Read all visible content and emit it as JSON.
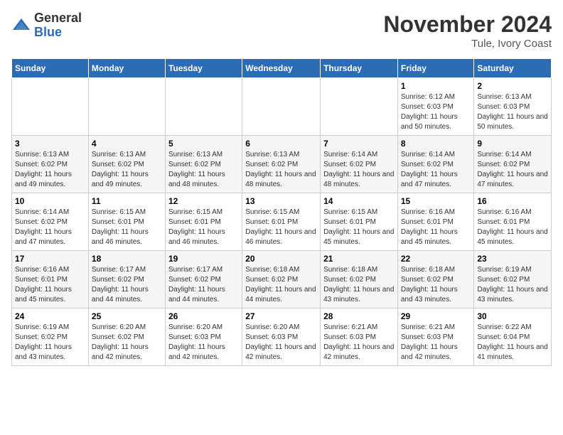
{
  "logo": {
    "general": "General",
    "blue": "Blue"
  },
  "title": "November 2024",
  "location": "Tule, Ivory Coast",
  "days_of_week": [
    "Sunday",
    "Monday",
    "Tuesday",
    "Wednesday",
    "Thursday",
    "Friday",
    "Saturday"
  ],
  "weeks": [
    [
      {
        "day": "",
        "info": ""
      },
      {
        "day": "",
        "info": ""
      },
      {
        "day": "",
        "info": ""
      },
      {
        "day": "",
        "info": ""
      },
      {
        "day": "",
        "info": ""
      },
      {
        "day": "1",
        "info": "Sunrise: 6:12 AM\nSunset: 6:03 PM\nDaylight: 11 hours and 50 minutes."
      },
      {
        "day": "2",
        "info": "Sunrise: 6:13 AM\nSunset: 6:03 PM\nDaylight: 11 hours and 50 minutes."
      }
    ],
    [
      {
        "day": "3",
        "info": "Sunrise: 6:13 AM\nSunset: 6:02 PM\nDaylight: 11 hours and 49 minutes."
      },
      {
        "day": "4",
        "info": "Sunrise: 6:13 AM\nSunset: 6:02 PM\nDaylight: 11 hours and 49 minutes."
      },
      {
        "day": "5",
        "info": "Sunrise: 6:13 AM\nSunset: 6:02 PM\nDaylight: 11 hours and 48 minutes."
      },
      {
        "day": "6",
        "info": "Sunrise: 6:13 AM\nSunset: 6:02 PM\nDaylight: 11 hours and 48 minutes."
      },
      {
        "day": "7",
        "info": "Sunrise: 6:14 AM\nSunset: 6:02 PM\nDaylight: 11 hours and 48 minutes."
      },
      {
        "day": "8",
        "info": "Sunrise: 6:14 AM\nSunset: 6:02 PM\nDaylight: 11 hours and 47 minutes."
      },
      {
        "day": "9",
        "info": "Sunrise: 6:14 AM\nSunset: 6:02 PM\nDaylight: 11 hours and 47 minutes."
      }
    ],
    [
      {
        "day": "10",
        "info": "Sunrise: 6:14 AM\nSunset: 6:02 PM\nDaylight: 11 hours and 47 minutes."
      },
      {
        "day": "11",
        "info": "Sunrise: 6:15 AM\nSunset: 6:01 PM\nDaylight: 11 hours and 46 minutes."
      },
      {
        "day": "12",
        "info": "Sunrise: 6:15 AM\nSunset: 6:01 PM\nDaylight: 11 hours and 46 minutes."
      },
      {
        "day": "13",
        "info": "Sunrise: 6:15 AM\nSunset: 6:01 PM\nDaylight: 11 hours and 46 minutes."
      },
      {
        "day": "14",
        "info": "Sunrise: 6:15 AM\nSunset: 6:01 PM\nDaylight: 11 hours and 45 minutes."
      },
      {
        "day": "15",
        "info": "Sunrise: 6:16 AM\nSunset: 6:01 PM\nDaylight: 11 hours and 45 minutes."
      },
      {
        "day": "16",
        "info": "Sunrise: 6:16 AM\nSunset: 6:01 PM\nDaylight: 11 hours and 45 minutes."
      }
    ],
    [
      {
        "day": "17",
        "info": "Sunrise: 6:16 AM\nSunset: 6:01 PM\nDaylight: 11 hours and 45 minutes."
      },
      {
        "day": "18",
        "info": "Sunrise: 6:17 AM\nSunset: 6:02 PM\nDaylight: 11 hours and 44 minutes."
      },
      {
        "day": "19",
        "info": "Sunrise: 6:17 AM\nSunset: 6:02 PM\nDaylight: 11 hours and 44 minutes."
      },
      {
        "day": "20",
        "info": "Sunrise: 6:18 AM\nSunset: 6:02 PM\nDaylight: 11 hours and 44 minutes."
      },
      {
        "day": "21",
        "info": "Sunrise: 6:18 AM\nSunset: 6:02 PM\nDaylight: 11 hours and 43 minutes."
      },
      {
        "day": "22",
        "info": "Sunrise: 6:18 AM\nSunset: 6:02 PM\nDaylight: 11 hours and 43 minutes."
      },
      {
        "day": "23",
        "info": "Sunrise: 6:19 AM\nSunset: 6:02 PM\nDaylight: 11 hours and 43 minutes."
      }
    ],
    [
      {
        "day": "24",
        "info": "Sunrise: 6:19 AM\nSunset: 6:02 PM\nDaylight: 11 hours and 43 minutes."
      },
      {
        "day": "25",
        "info": "Sunrise: 6:20 AM\nSunset: 6:02 PM\nDaylight: 11 hours and 42 minutes."
      },
      {
        "day": "26",
        "info": "Sunrise: 6:20 AM\nSunset: 6:03 PM\nDaylight: 11 hours and 42 minutes."
      },
      {
        "day": "27",
        "info": "Sunrise: 6:20 AM\nSunset: 6:03 PM\nDaylight: 11 hours and 42 minutes."
      },
      {
        "day": "28",
        "info": "Sunrise: 6:21 AM\nSunset: 6:03 PM\nDaylight: 11 hours and 42 minutes."
      },
      {
        "day": "29",
        "info": "Sunrise: 6:21 AM\nSunset: 6:03 PM\nDaylight: 11 hours and 42 minutes."
      },
      {
        "day": "30",
        "info": "Sunrise: 6:22 AM\nSunset: 6:04 PM\nDaylight: 11 hours and 41 minutes."
      }
    ]
  ]
}
